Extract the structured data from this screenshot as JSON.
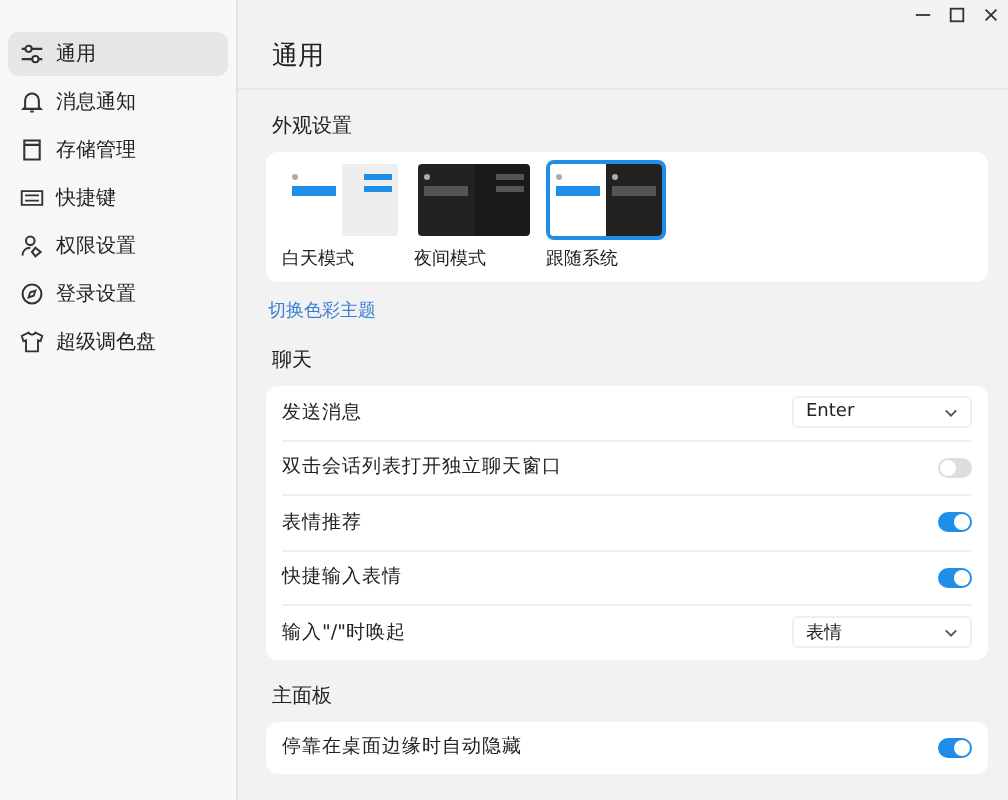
{
  "sidebar": {
    "items": [
      {
        "label": "通用",
        "selected": true
      },
      {
        "label": "消息通知",
        "selected": false
      },
      {
        "label": "存储管理",
        "selected": false
      },
      {
        "label": "快捷键",
        "selected": false
      },
      {
        "label": "权限设置",
        "selected": false
      },
      {
        "label": "登录设置",
        "selected": false
      },
      {
        "label": "超级调色盘",
        "selected": false
      }
    ]
  },
  "page": {
    "title": "通用"
  },
  "appearance": {
    "heading": "外观设置",
    "themes": [
      {
        "label": "白天模式",
        "kind": "light",
        "selected": false
      },
      {
        "label": "夜间模式",
        "kind": "dark",
        "selected": false
      },
      {
        "label": "跟随系统",
        "kind": "system",
        "selected": true
      }
    ],
    "link": "切换色彩主题"
  },
  "chat": {
    "heading": "聊天",
    "rows": [
      {
        "label": "发送消息",
        "kind": "select",
        "value": "Enter"
      },
      {
        "label": "双击会话列表打开独立聊天窗口",
        "kind": "toggle",
        "on": false
      },
      {
        "label": "表情推荐",
        "kind": "toggle",
        "on": true
      },
      {
        "label": "快捷输入表情",
        "kind": "toggle",
        "on": true
      },
      {
        "label": "输入\"/\"时唤起",
        "kind": "select",
        "value": "表情"
      }
    ]
  },
  "main_panel": {
    "heading": "主面板",
    "rows": [
      {
        "label": "停靠在桌面边缘时自动隐藏",
        "kind": "toggle",
        "on": true
      }
    ]
  }
}
